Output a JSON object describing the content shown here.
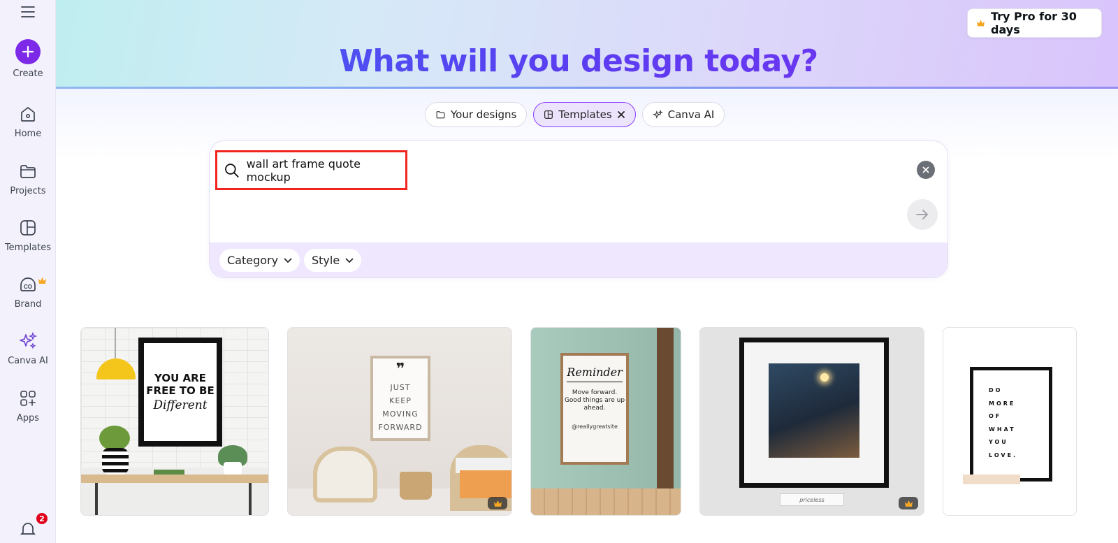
{
  "sidebar": {
    "create_label": "Create",
    "items": [
      {
        "label": "Home",
        "icon": "home-icon"
      },
      {
        "label": "Projects",
        "icon": "folder-icon"
      },
      {
        "label": "Templates",
        "icon": "templates-icon"
      },
      {
        "label": "Brand",
        "icon": "brand-icon"
      },
      {
        "label": "Canva AI",
        "icon": "sparkle-icon"
      },
      {
        "label": "Apps",
        "icon": "apps-icon"
      }
    ],
    "notification_count": "2"
  },
  "header": {
    "title": "What will you design today?",
    "pro_button": "Try Pro for 30 days"
  },
  "chips": [
    {
      "label": "Your designs",
      "icon": "folder-icon"
    },
    {
      "label": "Templates",
      "icon": "templates-icon",
      "active": true
    },
    {
      "label": "Canva AI",
      "icon": "sparkle-icon"
    }
  ],
  "search": {
    "value": "wall art frame quote mockup"
  },
  "filters": [
    {
      "label": "Category"
    },
    {
      "label": "Style"
    }
  ],
  "cards": [
    {
      "line1": "YOU ARE",
      "line2": "FREE TO BE",
      "line3": "Different"
    },
    {
      "mark": "❞",
      "lines": [
        "JUST",
        "KEEP",
        "MOVING",
        "FORWARD"
      ],
      "premium": true
    },
    {
      "title": "Reminder",
      "body": "Move forward. Good things are up ahead.",
      "site": "@reallygreatsite"
    },
    {
      "caption": "priceless",
      "premium": true
    },
    {
      "lines": [
        "DO",
        "MORE",
        "OF",
        "WHAT",
        "YOU",
        "LOVE."
      ]
    }
  ],
  "colors": {
    "brand_purple": "#7d2ae8",
    "highlight_red": "#f2241d",
    "crown_gold": "#f5a623"
  }
}
